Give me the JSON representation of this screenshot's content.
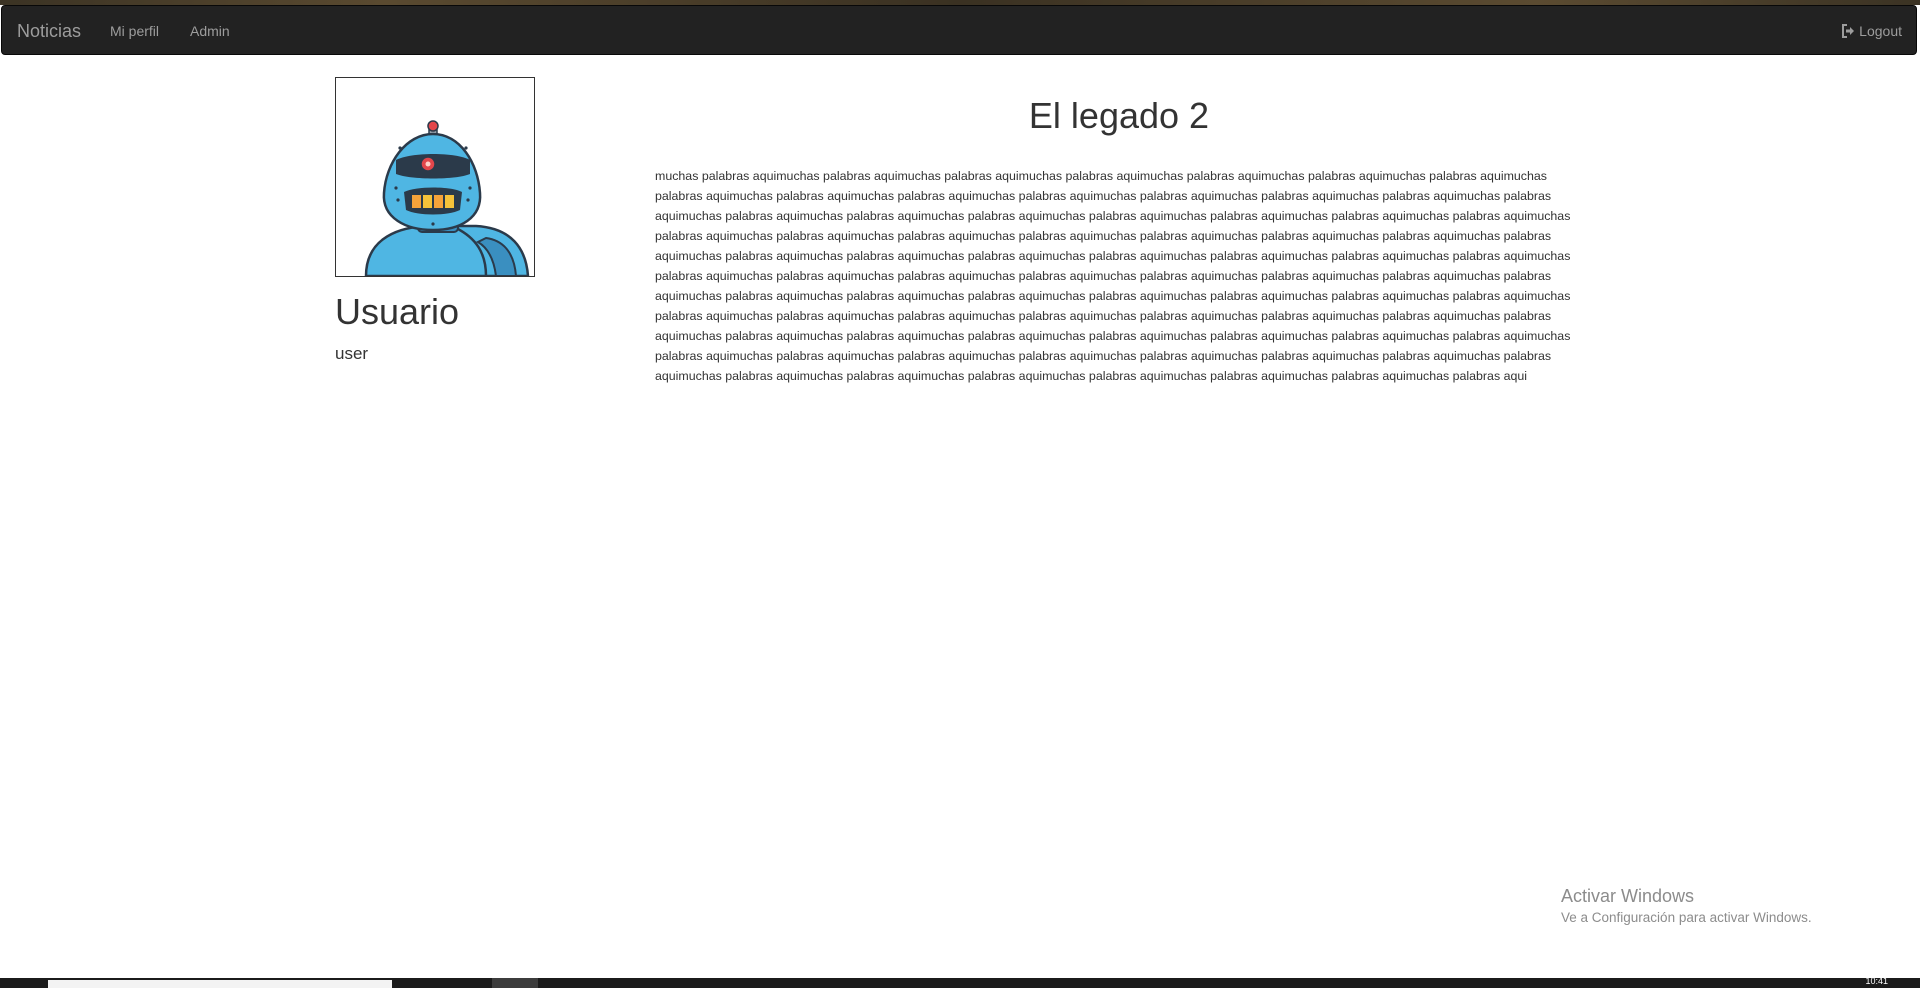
{
  "navbar": {
    "brand": "Noticias",
    "links": [
      "Mi perfil",
      "Admin"
    ],
    "logout_label": "Logout"
  },
  "profile": {
    "name": "Usuario",
    "role": "user"
  },
  "article": {
    "title": "El legado 2",
    "body": "muchas palabras aquimuchas palabras aquimuchas palabras aquimuchas palabras aquimuchas palabras aquimuchas palabras aquimuchas palabras aquimuchas palabras aquimuchas palabras aquimuchas palabras aquimuchas palabras aquimuchas palabras aquimuchas palabras aquimuchas palabras aquimuchas palabras aquimuchas palabras aquimuchas palabras aquimuchas palabras aquimuchas palabras aquimuchas palabras aquimuchas palabras aquimuchas palabras aquimuchas palabras aquimuchas palabras aquimuchas palabras aquimuchas palabras aquimuchas palabras aquimuchas palabras aquimuchas palabras aquimuchas palabras aquimuchas palabras aquimuchas palabras aquimuchas palabras aquimuchas palabras aquimuchas palabras aquimuchas palabras aquimuchas palabras aquimuchas palabras aquimuchas palabras aquimuchas palabras aquimuchas palabras aquimuchas palabras aquimuchas palabras aquimuchas palabras aquimuchas palabras aquimuchas palabras aquimuchas palabras aquimuchas palabras aquimuchas palabras aquimuchas palabras aquimuchas palabras aquimuchas palabras aquimuchas palabras aquimuchas palabras aquimuchas palabras aquimuchas palabras aquimuchas palabras aquimuchas palabras aquimuchas palabras aquimuchas palabras aquimuchas palabras aquimuchas palabras aquimuchas palabras aquimuchas palabras aquimuchas palabras aquimuchas palabras aquimuchas palabras aquimuchas palabras aquimuchas palabras aquimuchas palabras aquimuchas palabras aquimuchas palabras aquimuchas palabras aquimuchas palabras aquimuchas palabras aquimuchas palabras aquimuchas palabras aquimuchas palabras aquimuchas palabras aquimuchas palabras aquimuchas palabras aquimuchas palabras aqui"
  },
  "watermark": {
    "title": "Activar Windows",
    "subtitle": "Ve a Configuración para activar Windows."
  },
  "taskbar": {
    "clock": "10:41"
  },
  "colors": {
    "navbar_bg": "#222222",
    "nav_text": "#9d9d9d",
    "robot_blue": "#4fb6e3",
    "robot_outline": "#2b3a4a"
  }
}
